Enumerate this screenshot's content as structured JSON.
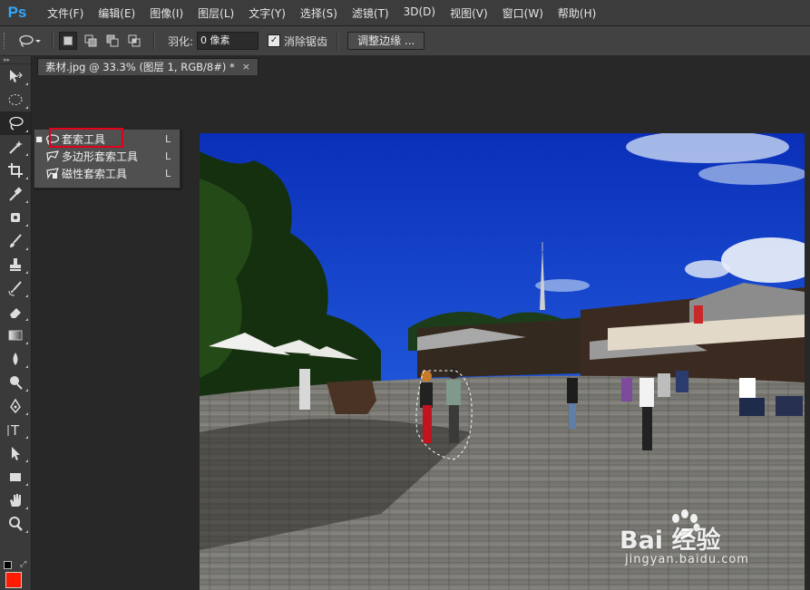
{
  "app": {
    "logo": "Ps"
  },
  "menu": [
    "文件(F)",
    "编辑(E)",
    "图像(I)",
    "图层(L)",
    "文字(Y)",
    "选择(S)",
    "滤镜(T)",
    "3D(D)",
    "视图(V)",
    "窗口(W)",
    "帮助(H)"
  ],
  "options": {
    "feather_label": "羽化:",
    "feather_value": "0 像素",
    "antialias_label": "消除锯齿",
    "antialias_checked": true,
    "refine_edge_label": "调整边缘 ..."
  },
  "document": {
    "tab_title": "素材.jpg @ 33.3% (图层 1, RGB/8#) *",
    "close_glyph": "×"
  },
  "tool_flyout": {
    "items": [
      {
        "label": "套索工具",
        "shortcut": "L",
        "icon": "lasso-icon",
        "selected": true
      },
      {
        "label": "多边形套索工具",
        "shortcut": "L",
        "icon": "polygonal-lasso-icon",
        "selected": false
      },
      {
        "label": "磁性套索工具",
        "shortcut": "L",
        "icon": "magnetic-lasso-icon",
        "selected": false
      }
    ]
  },
  "toolbox": {
    "tools": [
      "move-tool",
      "elliptical-marquee-tool",
      "lasso-tool",
      "magic-wand-tool",
      "crop-tool",
      "eyedropper-tool",
      "spot-healing-tool",
      "brush-tool",
      "clone-stamp-tool",
      "history-brush-tool",
      "eraser-tool",
      "gradient-tool",
      "blur-tool",
      "dodge-tool",
      "pen-tool",
      "type-tool",
      "path-selection-tool",
      "rectangle-tool",
      "hand-tool",
      "zoom-tool"
    ],
    "active": "lasso-tool",
    "foreground_color": "#ff1a00"
  },
  "watermark": {
    "main": "Bai  经验",
    "sub": "jingyan.baidu.com"
  },
  "colors": {
    "highlight_box": "#e0001a",
    "ps_blue": "#31a8ff"
  }
}
